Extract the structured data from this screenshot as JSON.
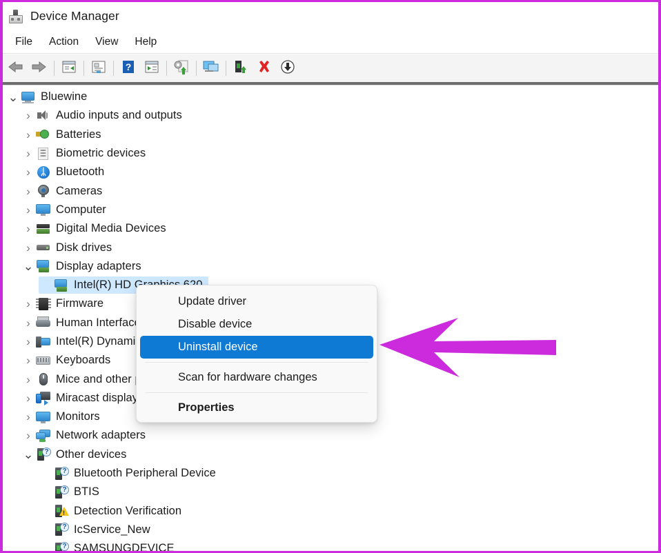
{
  "window": {
    "title": "Device Manager",
    "icon": "device-manager-icon"
  },
  "menubar": {
    "items": [
      {
        "label": "File"
      },
      {
        "label": "Action"
      },
      {
        "label": "View"
      },
      {
        "label": "Help"
      }
    ]
  },
  "toolbar": {
    "buttons": [
      {
        "name": "back-icon",
        "title": "Back"
      },
      {
        "name": "forward-icon",
        "title": "Forward"
      },
      {
        "name": "up-one-level-icon",
        "title": "Up one level"
      },
      {
        "name": "show-console-tree-icon",
        "title": "Show/Hide Console Tree"
      },
      {
        "name": "properties-icon",
        "title": "Properties"
      },
      {
        "name": "help-icon",
        "title": "Help"
      },
      {
        "name": "show-hidden-devices-icon",
        "title": "Show hidden devices"
      },
      {
        "name": "update-driver-icon",
        "title": "Update driver"
      },
      {
        "name": "scan-hardware-changes-icon",
        "title": "Scan for hardware changes"
      },
      {
        "name": "disable-device-icon",
        "title": "Disable device"
      },
      {
        "name": "uninstall-device-icon",
        "title": "Uninstall device"
      },
      {
        "name": "download-icon",
        "title": "Download"
      }
    ]
  },
  "tree": {
    "nodes": [
      {
        "label": "Bluewine",
        "depth": 1,
        "state": "expanded",
        "icon": "computer-icon",
        "selected": false
      },
      {
        "label": "Audio inputs and outputs",
        "depth": 2,
        "state": "collapsed",
        "icon": "speaker-icon",
        "selected": false
      },
      {
        "label": "Batteries",
        "depth": 2,
        "state": "collapsed",
        "icon": "battery-icon",
        "selected": false
      },
      {
        "label": "Biometric devices",
        "depth": 2,
        "state": "collapsed",
        "icon": "fingerprint-icon",
        "selected": false
      },
      {
        "label": "Bluetooth",
        "depth": 2,
        "state": "collapsed",
        "icon": "bluetooth-icon",
        "selected": false
      },
      {
        "label": "Cameras",
        "depth": 2,
        "state": "collapsed",
        "icon": "camera-icon",
        "selected": false
      },
      {
        "label": "Computer",
        "depth": 2,
        "state": "collapsed",
        "icon": "monitor-icon",
        "selected": false
      },
      {
        "label": "Digital Media Devices",
        "depth": 2,
        "state": "collapsed",
        "icon": "media-device-icon",
        "selected": false
      },
      {
        "label": "Disk drives",
        "depth": 2,
        "state": "collapsed",
        "icon": "disk-drive-icon",
        "selected": false
      },
      {
        "label": "Display adapters",
        "depth": 2,
        "state": "expanded",
        "icon": "display-adapter-icon",
        "selected": false
      },
      {
        "label": "Intel(R) HD Graphics 620",
        "depth": 3,
        "state": "leaf",
        "icon": "display-adapter-icon",
        "selected": true
      },
      {
        "label": "Firmware",
        "depth": 2,
        "state": "collapsed",
        "icon": "firmware-chip-icon",
        "selected": false
      },
      {
        "label": "Human Interface Devices",
        "depth": 2,
        "state": "collapsed",
        "icon": "hid-icon",
        "selected": false
      },
      {
        "label": "Intel(R) Dynamic Platform and Thermal Framework",
        "depth": 2,
        "state": "collapsed",
        "icon": "intel-platform-icon",
        "selected": false
      },
      {
        "label": "Keyboards",
        "depth": 2,
        "state": "collapsed",
        "icon": "keyboard-icon",
        "selected": false
      },
      {
        "label": "Mice and other pointing devices",
        "depth": 2,
        "state": "collapsed",
        "icon": "mouse-icon",
        "selected": false
      },
      {
        "label": "Miracast display devices",
        "depth": 2,
        "state": "collapsed",
        "icon": "miracast-icon",
        "selected": false
      },
      {
        "label": "Monitors",
        "depth": 2,
        "state": "collapsed",
        "icon": "monitor-icon",
        "selected": false
      },
      {
        "label": "Network adapters",
        "depth": 2,
        "state": "collapsed",
        "icon": "network-adapter-icon",
        "selected": false
      },
      {
        "label": "Other devices",
        "depth": 2,
        "state": "expanded",
        "icon": "unknown-device-icon",
        "selected": false
      },
      {
        "label": "Bluetooth Peripheral Device",
        "depth": 3,
        "state": "leaf",
        "icon": "unknown-device-icon",
        "selected": false
      },
      {
        "label": "BTIS",
        "depth": 3,
        "state": "leaf",
        "icon": "unknown-device-icon",
        "selected": false
      },
      {
        "label": "Detection Verification",
        "depth": 3,
        "state": "leaf",
        "icon": "warning-device-icon",
        "selected": false
      },
      {
        "label": "IcService_New",
        "depth": 3,
        "state": "leaf",
        "icon": "unknown-device-icon",
        "selected": false
      },
      {
        "label": "SAMSUNGDEVICE",
        "depth": 3,
        "state": "leaf",
        "icon": "unknown-device-icon",
        "selected": false
      }
    ]
  },
  "context_menu": {
    "items": [
      {
        "label": "Update driver",
        "highlighted": false,
        "bold": false
      },
      {
        "label": "Disable device",
        "highlighted": false,
        "bold": false
      },
      {
        "label": "Uninstall device",
        "highlighted": true,
        "bold": false
      },
      {
        "separator": true
      },
      {
        "label": "Scan for hardware changes",
        "highlighted": false,
        "bold": false
      },
      {
        "separator": true
      },
      {
        "label": "Properties",
        "highlighted": false,
        "bold": true
      }
    ]
  },
  "annotation": {
    "arrow": {
      "name": "magenta-pointer-arrow",
      "color": "#cc2bdd",
      "direction": "left",
      "points_to": "Uninstall device"
    }
  },
  "colors": {
    "accent_highlight": "#0f7ad4",
    "selection_blue": "#cde8ff",
    "border_magenta": "#cc2bdd",
    "toolbar_bg": "#f4f4f4",
    "menu_bg": "#f9f9f9"
  }
}
